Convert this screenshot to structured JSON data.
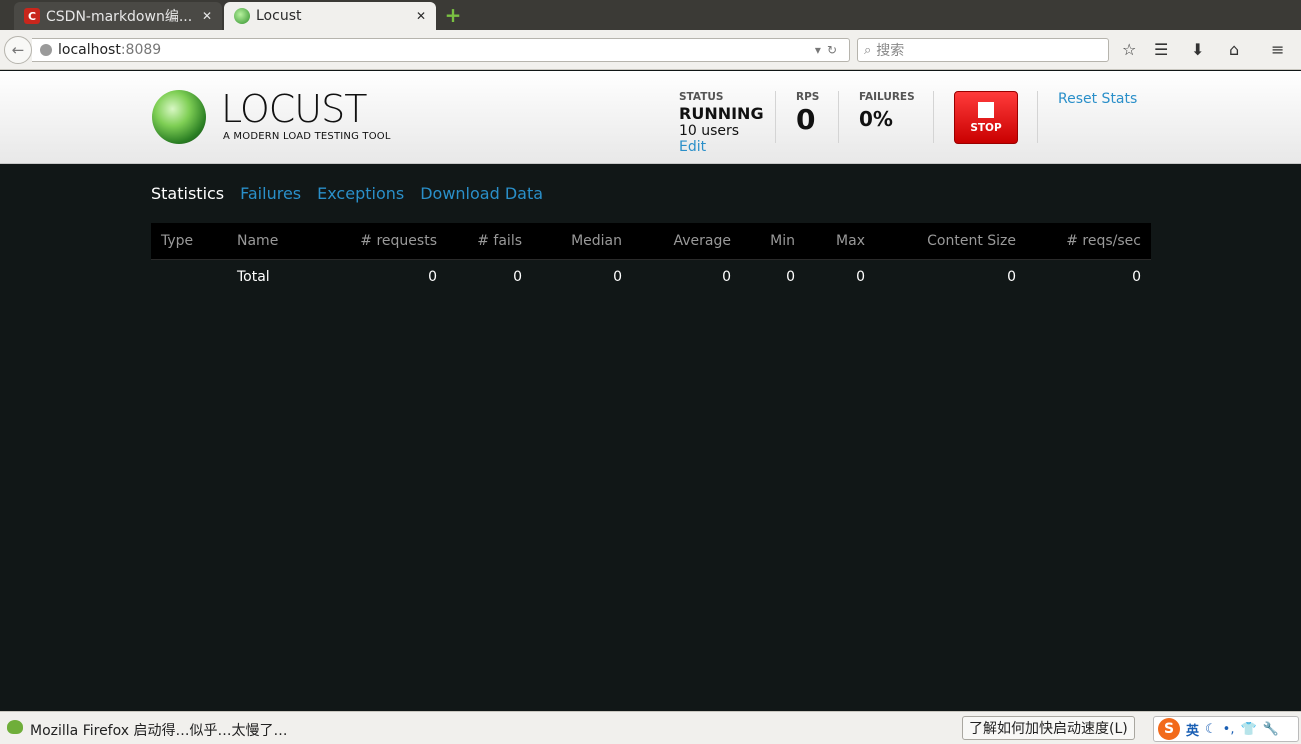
{
  "browser": {
    "tabs": [
      {
        "title": "CSDN-markdown编...",
        "favicon": "csdn-icon",
        "active": false
      },
      {
        "title": "Locust",
        "favicon": "locust-icon",
        "active": true
      }
    ],
    "url_host": "localhost",
    "url_port": ":8089",
    "search_placeholder": "搜索",
    "status_message": "Mozilla Firefox 启动得…似乎…太慢了…",
    "learn_button": "了解如何加快启动速度(L)",
    "ime_language": "英"
  },
  "header": {
    "logo_title": "LOCUST",
    "logo_subtitle": "A MODERN LOAD TESTING TOOL",
    "status_label": "STATUS",
    "status_value": "RUNNING",
    "users": "10 users",
    "edit_link": "Edit",
    "rps_label": "RPS",
    "rps_value": "0",
    "failures_label": "FAILURES",
    "failures_value": "0%",
    "stop_label": "STOP",
    "reset_link": "Reset Stats"
  },
  "tabs": [
    "Statistics",
    "Failures",
    "Exceptions",
    "Download Data"
  ],
  "table": {
    "columns": [
      "Type",
      "Name",
      "# requests",
      "# fails",
      "Median",
      "Average",
      "Min",
      "Max",
      "Content Size",
      "# reqs/sec"
    ],
    "total_row": [
      "",
      "Total",
      "0",
      "0",
      "0",
      "0",
      "0",
      "0",
      "0",
      "0"
    ]
  },
  "colors": {
    "accent": "#2a8fc9",
    "page_background": "#111717",
    "stop_red": "#e00000"
  }
}
